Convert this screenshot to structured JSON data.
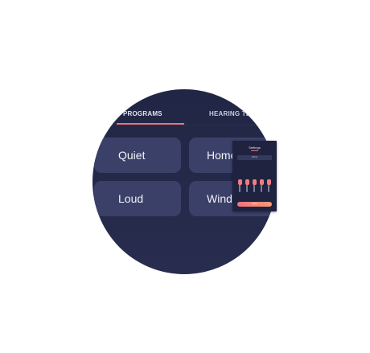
{
  "tabs": [
    {
      "label": "PROGRAMS"
    },
    {
      "label": "HEARING TES"
    }
  ],
  "programs": [
    {
      "label": "Quiet"
    },
    {
      "label": "Home"
    },
    {
      "label": "Loud"
    },
    {
      "label": "Windy"
    }
  ],
  "settings_preview": {
    "title": "Settings",
    "field": "Windy",
    "sliders": [
      "",
      "",
      "",
      "",
      ""
    ],
    "button": "Save"
  },
  "colors": {
    "background": "#222645",
    "card": "#3a4068",
    "accent": "#e9737a"
  }
}
